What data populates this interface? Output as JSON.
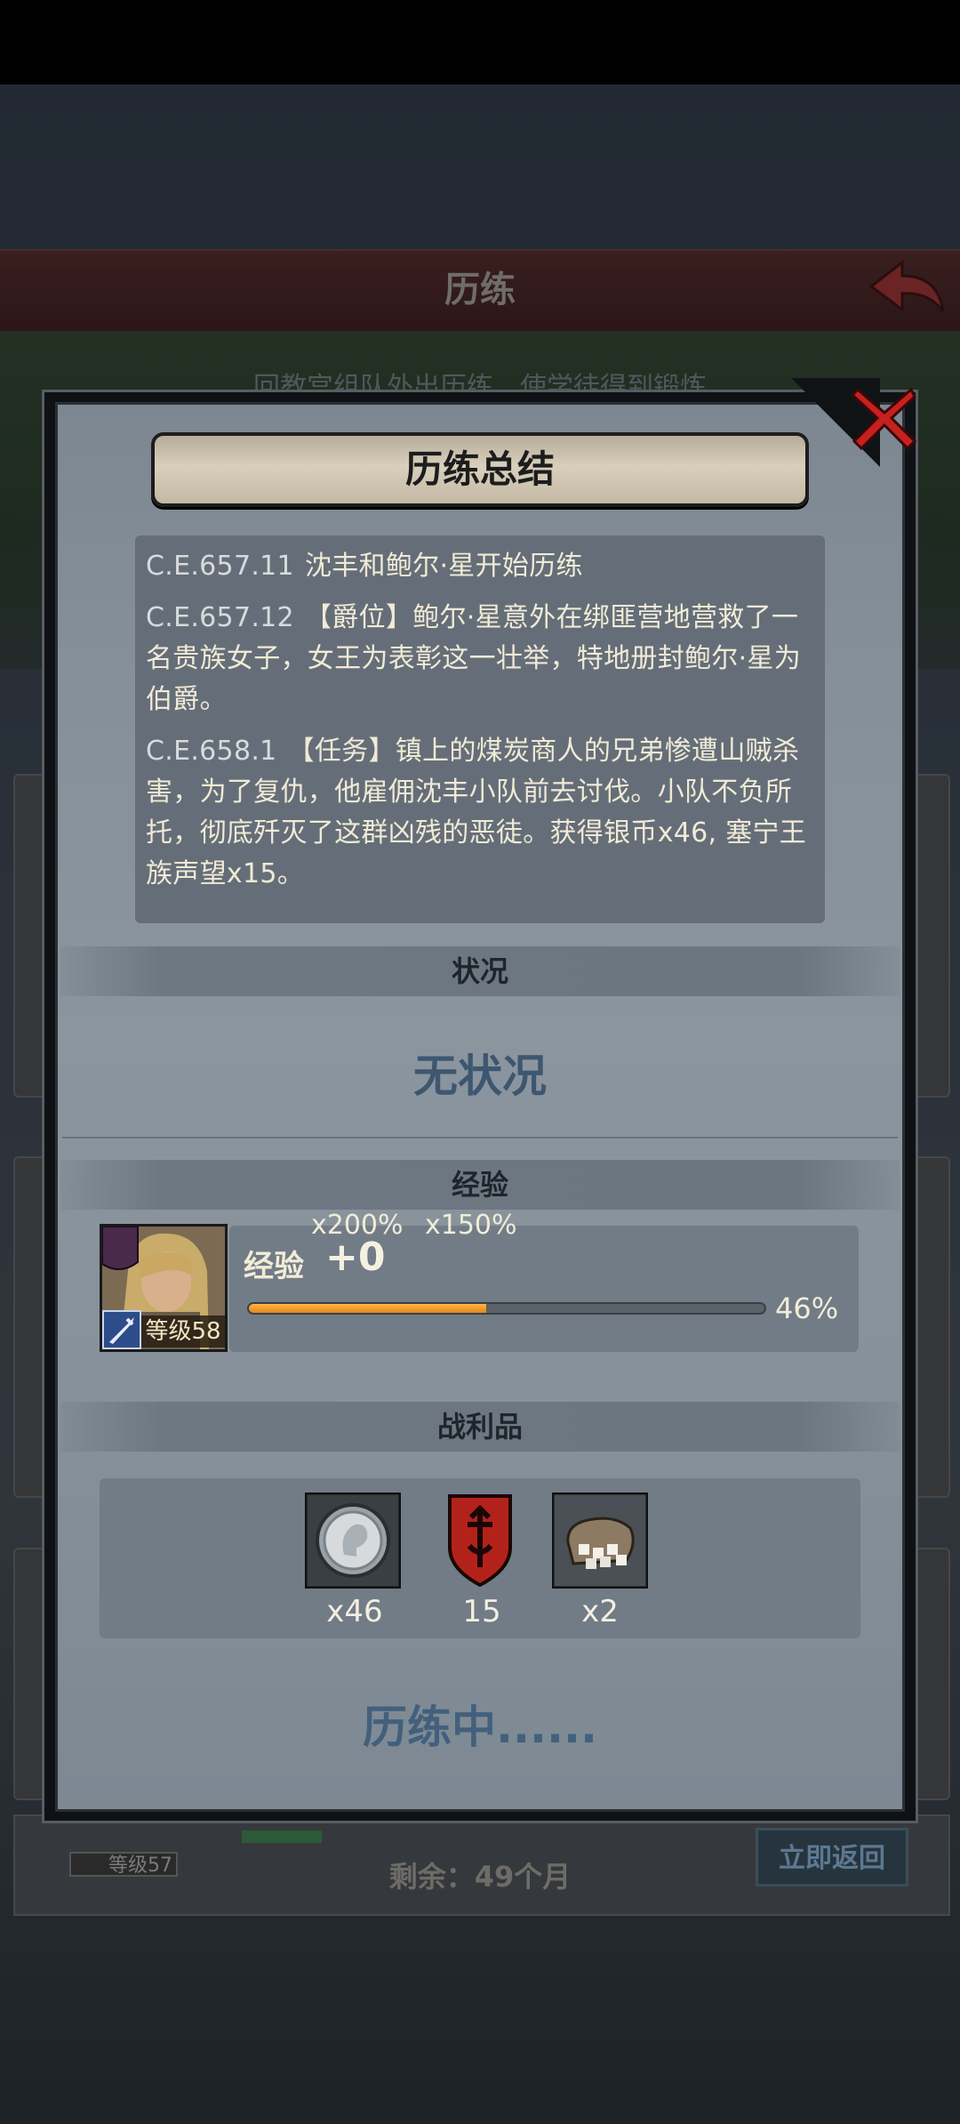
{
  "background": {
    "header_title": "历练",
    "intro_text": "回教宫组队外出历练，使学徒得到锻炼",
    "level_badge": "等级57",
    "remaining_text": "剩余：49个月",
    "return_button": "立即返回"
  },
  "modal": {
    "title": "历练总结",
    "log": [
      {
        "date": "C.E.657.11",
        "text": "沈丰和鲍尔·星开始历练"
      },
      {
        "date": "C.E.657.12",
        "text": "【爵位】鲍尔·星意外在绑匪营地营救了一名贵族女子，女王为表彰这一壮举，特地册封鲍尔·星为伯爵。"
      },
      {
        "date": "C.E.658.1",
        "text": "【任务】镇上的煤炭商人的兄弟惨遭山贼杀害，为了复仇，他雇佣沈丰小队前去讨伐。小队不负所托，彻底歼灭了这群凶残的恶徒。获得银币x46, 塞宁王族声望x15。"
      }
    ],
    "status_section": {
      "label": "状况",
      "value": "无状况"
    },
    "experience_section": {
      "label": "经验",
      "multiplier_1": "x200%",
      "multiplier_2": "x150%",
      "exp_label": "经验",
      "exp_gain": "+0",
      "progress": 0.46,
      "progress_text": "46%",
      "level_badge": "等级58"
    },
    "loot_section": {
      "label": "战利品",
      "items": [
        {
          "icon": "silver-coin-icon",
          "count": "x46"
        },
        {
          "icon": "royal-reputation-shield-icon",
          "count": "15"
        },
        {
          "icon": "supply-sack-icon",
          "count": "x2"
        }
      ]
    },
    "footer_text": "历练中......"
  },
  "colors": {
    "accent_orange": "#f0a030",
    "status_blue": "#3d5770",
    "close_red": "#c8201e"
  }
}
